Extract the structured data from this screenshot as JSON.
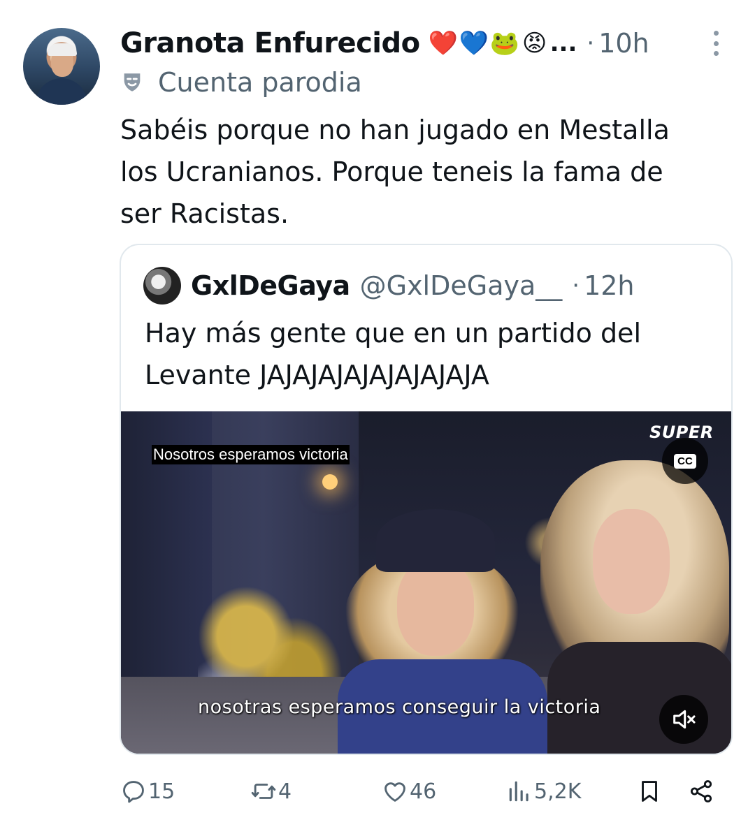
{
  "tweet": {
    "display_name": "Granota Enfurecido",
    "name_emojis": [
      "❤️",
      "💙",
      "🐸",
      "😡"
    ],
    "name_ellipsis": "...",
    "separator": "·",
    "time": "10h",
    "parody_label": "Cuenta parodia",
    "text": "Sabéis porque no han jugado en Mestalla\nlos Ucranianos. Porque teneis la fama de\nser Racistas."
  },
  "quote": {
    "display_name": "GxlDeGaya",
    "handle": "@GxlDeGaya__",
    "separator": "·",
    "time": "12h",
    "text": "Hay más gente que en un partido del\nLevante JAJAJAJAJAJAJAJAJA",
    "video": {
      "caption_top": "Nosotros esperamos victoria",
      "caption_bottom": "nosotras esperamos conseguir la victoria",
      "channel_logo": "SUPER",
      "cc_label": "CC"
    }
  },
  "actions": {
    "replies": "15",
    "reposts": "4",
    "likes": "46",
    "views": "5,2K"
  },
  "icons": {
    "more": "more-vertical-icon",
    "parody": "theater-mask-icon",
    "cc": "closed-captions-icon",
    "mute": "volume-muted-icon",
    "reply": "reply-icon",
    "repost": "repost-icon",
    "like": "heart-icon",
    "views": "views-icon",
    "bookmark": "bookmark-icon",
    "share": "share-icon"
  },
  "colors": {
    "text": "#0f1419",
    "secondary": "#536471",
    "border": "#e1e8ed"
  }
}
